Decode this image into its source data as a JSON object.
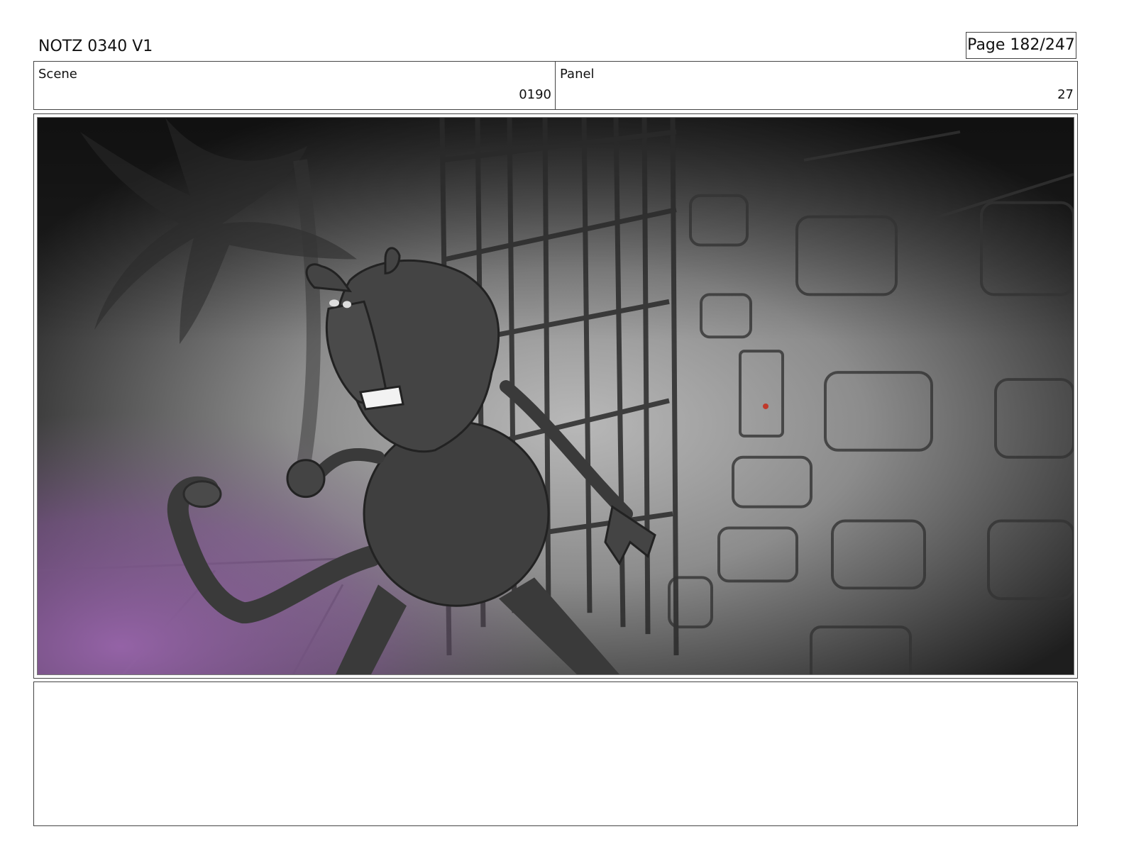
{
  "header": {
    "title": "NOTZ 0340 V1",
    "page": "Page 182/247"
  },
  "info": {
    "scene_label": "Scene",
    "scene_value": "0190",
    "panel_label": "Panel",
    "panel_value": "27"
  },
  "panel_image": {
    "depicts": "storyboard-sketch",
    "palette": {
      "dark": "#1c1c1c",
      "mid": "#8a8a8a",
      "light": "#b4b4b4",
      "accent": "#9a66ad",
      "character": "#3f3f3f"
    }
  },
  "notes": {
    "text": ""
  }
}
